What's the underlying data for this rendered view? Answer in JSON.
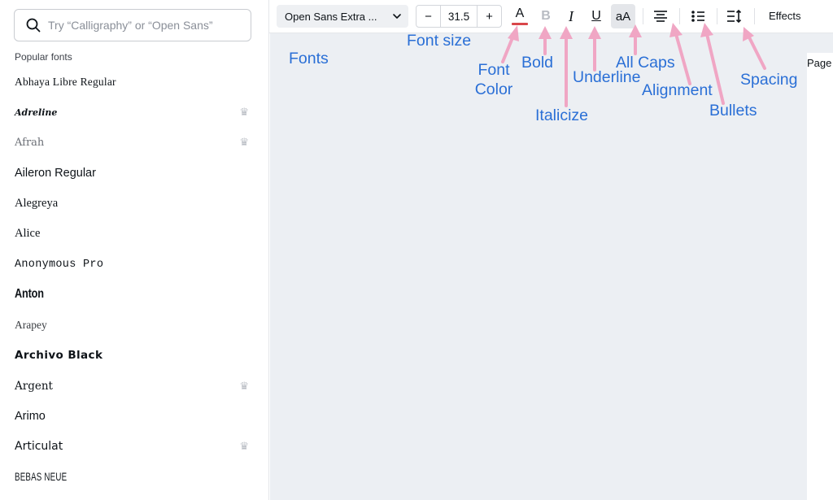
{
  "sidebar": {
    "search_placeholder": "Try “Calligraphy” or “Open Sans”",
    "section_title": "Popular fonts",
    "fonts": [
      {
        "name": "Abhaya Libre Regular",
        "premium": false
      },
      {
        "name": "Adreline",
        "premium": true
      },
      {
        "name": "Afrah",
        "premium": true
      },
      {
        "name": "Aileron Regular",
        "premium": false
      },
      {
        "name": "Alegreya",
        "premium": false
      },
      {
        "name": "Alice",
        "premium": false
      },
      {
        "name": "Anonymous Pro",
        "premium": false
      },
      {
        "name": "Anton",
        "premium": false
      },
      {
        "name": "Arapey",
        "premium": false
      },
      {
        "name": "Archivo Black",
        "premium": false
      },
      {
        "name": "Argent",
        "premium": true
      },
      {
        "name": "Arimo",
        "premium": false
      },
      {
        "name": "Articulat",
        "premium": true
      },
      {
        "name": "BEBAS NEUE",
        "premium": false
      }
    ],
    "crown_glyph": "♛"
  },
  "toolbar": {
    "font_name": "Open Sans Extra ...",
    "minus_label": "−",
    "font_size": "31.5",
    "plus_label": "+",
    "color_letter": "A",
    "text_color": "#d9464a",
    "bold_label": "B",
    "italic_label": "I",
    "underline_label": "U",
    "caps_label": "aA",
    "effects_label": "Effects"
  },
  "canvas": {
    "page_label": "Page"
  },
  "annotations": {
    "fonts": "Fonts",
    "font_size": "Font size",
    "font_color_1": "Font",
    "font_color_2": "Color",
    "bold": "Bold",
    "italicize": "Italicize",
    "underline": "Underline",
    "all_caps": "All Caps",
    "alignment": "Alignment",
    "bullets": "Bullets",
    "spacing": "Spacing",
    "label_color": "#2a6fd6",
    "arrow_color": "#f0a6c4"
  }
}
